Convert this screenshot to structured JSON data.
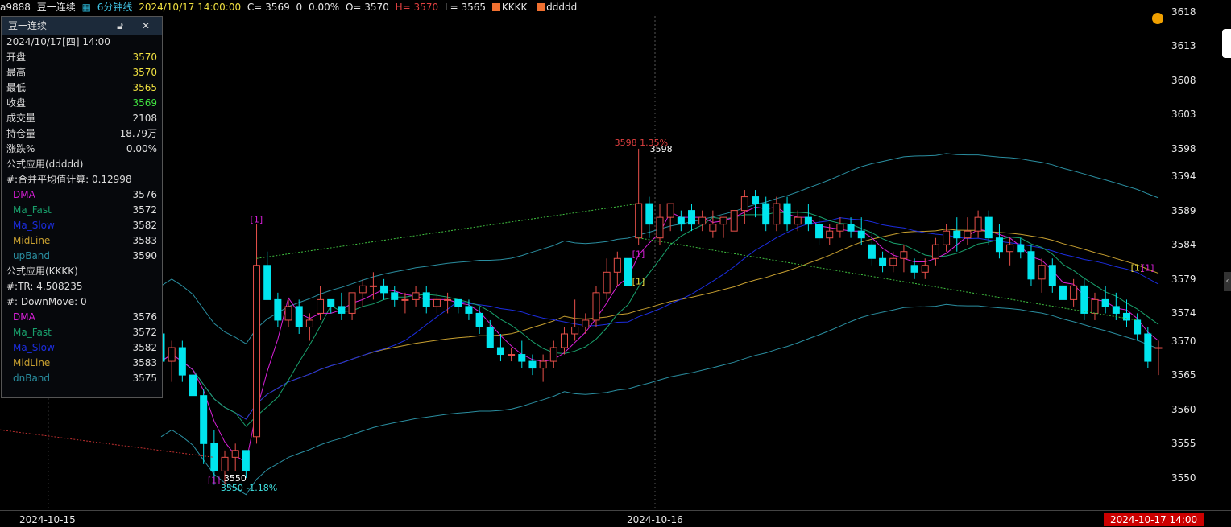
{
  "topbar": {
    "symbol": "a9888",
    "name": "豆一连续",
    "period": "6分钟线",
    "datetime": "2024/10/17 14:00:00",
    "close": "C= 3569",
    "change": "0",
    "pct": "0.00%",
    "open": "O= 3570",
    "high": "H= 3570",
    "low": "L= 3565",
    "ind1": "KKKK",
    "ind2": "ddddd"
  },
  "colors": {
    "up": "#e8504a",
    "down": "#00e5ee",
    "dma": "#d81fd8",
    "fast": "#19a06c",
    "slow": "#1c2de0",
    "mid": "#c8a030",
    "band": "#2a8ea0",
    "highlight_red": "#e04040"
  },
  "panel": {
    "title": "豆一连续",
    "date": "2024/10/17[四] 14:00",
    "rows": [
      {
        "label": "开盘",
        "value": "3570",
        "color": "#f0e040"
      },
      {
        "label": "最高",
        "value": "3570",
        "color": "#f0e040"
      },
      {
        "label": "最低",
        "value": "3565",
        "color": "#f0e040"
      },
      {
        "label": "收盘",
        "value": "3569",
        "color": "#40e040"
      },
      {
        "label": "成交量",
        "value": "2108",
        "color": "#e0e0e0"
      },
      {
        "label": "持仓量",
        "value": "18.79万",
        "color": "#e0e0e0"
      },
      {
        "label": "涨跌%",
        "value": "0.00%",
        "color": "#e0e0e0"
      }
    ],
    "f1_title": "公式应用(ddddd)",
    "f1_calc": "#:合并平均值计算: 0.12998",
    "f1_rows": [
      {
        "label": "DMA",
        "value": "3576",
        "color": "#d81fd8"
      },
      {
        "label": "Ma_Fast",
        "value": "3572",
        "color": "#19a06c"
      },
      {
        "label": "Ma_Slow",
        "value": "3582",
        "color": "#1c2de0"
      },
      {
        "label": "MidLine",
        "value": "3583",
        "color": "#c8a030"
      },
      {
        "label": "upBand",
        "value": "3590",
        "color": "#2a8ea0"
      }
    ],
    "f2_title": "公式应用(KKKK)",
    "f2_tr": "#:TR:  4.508235",
    "f2_dm": "#:  DownMove:  0",
    "f2_rows": [
      {
        "label": "DMA",
        "value": "3576",
        "color": "#d81fd8"
      },
      {
        "label": "Ma_Fast",
        "value": "3572",
        "color": "#19a06c"
      },
      {
        "label": "Ma_Slow",
        "value": "3582",
        "color": "#1c2de0"
      },
      {
        "label": "MidLine",
        "value": "3583",
        "color": "#c8a030"
      },
      {
        "label": "dnBand",
        "value": "3575",
        "color": "#2a8ea0"
      }
    ]
  },
  "yaxis": {
    "ticks": [
      "3618",
      "3613",
      "3608",
      "3603",
      "3598",
      "3594",
      "3589",
      "3584",
      "3579",
      "3574",
      "3570",
      "3565",
      "3560",
      "3555",
      "3550"
    ],
    "range": [
      3546,
      3619
    ]
  },
  "xaxis": {
    "labels": [
      "2024-10-15",
      "2024-10-16"
    ],
    "current": "2024-10-17 14:00"
  },
  "annotations": {
    "high_label": "3598 1.35%",
    "high_value": "3598",
    "low_value": "3550",
    "low_label": "3550 -1.18%",
    "marker": "[1]"
  },
  "chart_data": {
    "type": "candlestick",
    "candles": [
      [
        3571,
        3572,
        3566,
        3567
      ],
      [
        3567,
        3570,
        3564,
        3569
      ],
      [
        3569,
        3570,
        3564,
        3565
      ],
      [
        3565,
        3566,
        3561,
        3562
      ],
      [
        3562,
        3563,
        3552,
        3555
      ],
      [
        3555,
        3557,
        3549,
        3551
      ],
      [
        3551,
        3554,
        3549,
        3553
      ],
      [
        3553,
        3555,
        3551,
        3554
      ],
      [
        3554,
        3554,
        3550,
        3551
      ],
      [
        3556,
        3587,
        3555,
        3581
      ],
      [
        3581,
        3583,
        3576,
        3576
      ],
      [
        3576,
        3577,
        3572,
        3573
      ],
      [
        3573,
        3576,
        3572,
        3575
      ],
      [
        3575,
        3576,
        3571,
        3572
      ],
      [
        3572,
        3574,
        3570,
        3573
      ],
      [
        3574,
        3578,
        3573,
        3576
      ],
      [
        3576,
        3576,
        3574,
        3575
      ],
      [
        3575,
        3577,
        3573,
        3574
      ],
      [
        3574,
        3577,
        3573,
        3577
      ],
      [
        3577,
        3579,
        3575,
        3578
      ],
      [
        3578,
        3580,
        3576,
        3578
      ],
      [
        3578,
        3579,
        3576,
        3577
      ],
      [
        3577,
        3578,
        3575,
        3576
      ],
      [
        3576,
        3577,
        3574,
        3576
      ],
      [
        3576,
        3578,
        3575,
        3577
      ],
      [
        3577,
        3578,
        3574,
        3575
      ],
      [
        3575,
        3577,
        3574,
        3576
      ],
      [
        3576,
        3577,
        3574,
        3576
      ],
      [
        3576,
        3576,
        3574,
        3575
      ],
      [
        3575,
        3576,
        3573,
        3574
      ],
      [
        3574,
        3575,
        3571,
        3572
      ],
      [
        3572,
        3573,
        3569,
        3569
      ],
      [
        3569,
        3571,
        3567,
        3568
      ],
      [
        3568,
        3569,
        3567,
        3568
      ],
      [
        3568,
        3570,
        3566,
        3567
      ],
      [
        3567,
        3568,
        3565,
        3566
      ],
      [
        3566,
        3568,
        3564,
        3567
      ],
      [
        3567,
        3570,
        3566,
        3569
      ],
      [
        3569,
        3572,
        3568,
        3571
      ],
      [
        3571,
        3576,
        3570,
        3572
      ],
      [
        3572,
        3574,
        3571,
        3573
      ],
      [
        3573,
        3578,
        3572,
        3577
      ],
      [
        3577,
        3582,
        3576,
        3580
      ],
      [
        3580,
        3583,
        3578,
        3582
      ],
      [
        3582,
        3583,
        3577,
        3578
      ],
      [
        3585,
        3598,
        3584,
        3590
      ],
      [
        3590,
        3591,
        3585,
        3587
      ],
      [
        3585,
        3590,
        3584,
        3588
      ],
      [
        3588,
        3590,
        3586,
        3590
      ],
      [
        3588,
        3589,
        3586,
        3587
      ],
      [
        3589,
        3590,
        3586,
        3587
      ],
      [
        3587,
        3589,
        3586,
        3588
      ],
      [
        3586,
        3589,
        3585,
        3587
      ],
      [
        3587,
        3588,
        3585,
        3588
      ],
      [
        3586,
        3589,
        3586,
        3589
      ],
      [
        3589,
        3592,
        3587,
        3591
      ],
      [
        3591,
        3592,
        3588,
        3590
      ],
      [
        3590,
        3591,
        3586,
        3587
      ],
      [
        3587,
        3591,
        3586,
        3590
      ],
      [
        3590,
        3591,
        3586,
        3587
      ],
      [
        3587,
        3589,
        3586,
        3588
      ],
      [
        3588,
        3590,
        3586,
        3587
      ],
      [
        3587,
        3588,
        3584,
        3585
      ],
      [
        3585,
        3587,
        3584,
        3586
      ],
      [
        3586,
        3588,
        3585,
        3587
      ],
      [
        3587,
        3588,
        3585,
        3586
      ],
      [
        3586,
        3588,
        3584,
        3585
      ],
      [
        3584,
        3586,
        3581,
        3582
      ],
      [
        3582,
        3583,
        3580,
        3581
      ],
      [
        3581,
        3583,
        3580,
        3582
      ],
      [
        3582,
        3584,
        3580,
        3583
      ],
      [
        3581,
        3582,
        3579,
        3580
      ],
      [
        3580,
        3582,
        3579,
        3581
      ],
      [
        3582,
        3585,
        3581,
        3584
      ],
      [
        3584,
        3587,
        3583,
        3586
      ],
      [
        3586,
        3588,
        3583,
        3585
      ],
      [
        3585,
        3588,
        3584,
        3586
      ],
      [
        3586,
        3589,
        3585,
        3588
      ],
      [
        3588,
        3589,
        3584,
        3585
      ],
      [
        3585,
        3587,
        3582,
        3583
      ],
      [
        3583,
        3585,
        3581,
        3584
      ],
      [
        3584,
        3585,
        3582,
        3583
      ],
      [
        3583,
        3584,
        3578,
        3579
      ],
      [
        3579,
        3582,
        3577,
        3581
      ],
      [
        3581,
        3582,
        3577,
        3578
      ],
      [
        3578,
        3579,
        3576,
        3576
      ],
      [
        3576,
        3579,
        3575,
        3578
      ],
      [
        3578,
        3579,
        3573,
        3574
      ],
      [
        3574,
        3577,
        3573,
        3576
      ],
      [
        3576,
        3578,
        3574,
        3575
      ],
      [
        3575,
        3577,
        3573,
        3574
      ],
      [
        3574,
        3576,
        3572,
        3573
      ],
      [
        3573,
        3574,
        3570,
        3571
      ],
      [
        3571,
        3572,
        3566,
        3567
      ],
      [
        3569,
        3570,
        3565,
        3569
      ]
    ]
  }
}
